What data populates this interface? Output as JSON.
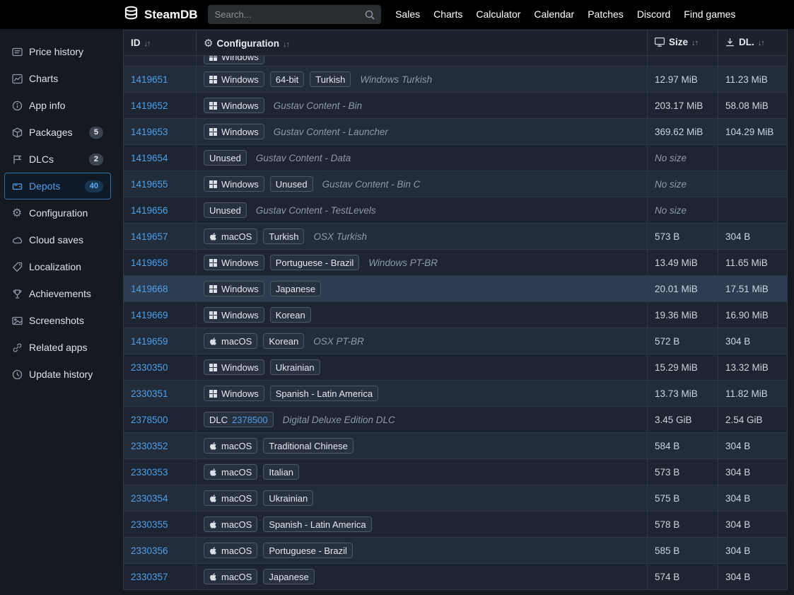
{
  "header": {
    "brand": "SteamDB",
    "search_placeholder": "Search...",
    "nav": [
      "Sales",
      "Charts",
      "Calculator",
      "Calendar",
      "Patches",
      "Discord",
      "Find games"
    ]
  },
  "sidebar": {
    "items": [
      {
        "label": "Price history"
      },
      {
        "label": "Charts"
      },
      {
        "label": "App info"
      },
      {
        "label": "Packages",
        "badge": "5"
      },
      {
        "label": "DLCs",
        "badge": "2"
      },
      {
        "label": "Depots",
        "badge": "40",
        "selected": true
      },
      {
        "label": "Configuration"
      },
      {
        "label": "Cloud saves"
      },
      {
        "label": "Localization"
      },
      {
        "label": "Achievements"
      },
      {
        "label": "Screenshots"
      },
      {
        "label": "Related apps"
      },
      {
        "label": "Update history"
      }
    ]
  },
  "table": {
    "sort_indicator": "↓↑",
    "columns": [
      {
        "label": "ID"
      },
      {
        "label": "Configuration"
      },
      {
        "label": "Size"
      },
      {
        "label": "DL."
      }
    ],
    "rows": [
      {
        "partial": true,
        "badges": [
          {
            "type": "windows",
            "label": "Windows"
          }
        ]
      },
      {
        "id": "1419651",
        "badges": [
          {
            "type": "windows",
            "label": "Windows"
          },
          {
            "type": "plain",
            "label": "64-bit"
          },
          {
            "type": "plain",
            "label": "Turkish"
          }
        ],
        "desc": "Windows Turkish",
        "size": "12.97 MiB",
        "dl": "11.23 MiB"
      },
      {
        "id": "1419652",
        "badges": [
          {
            "type": "windows",
            "label": "Windows"
          }
        ],
        "desc": "Gustav Content - Bin",
        "size": "203.17 MiB",
        "dl": "58.08 MiB"
      },
      {
        "id": "1419653",
        "badges": [
          {
            "type": "windows",
            "label": "Windows"
          }
        ],
        "desc": "Gustav Content - Launcher",
        "size": "369.62 MiB",
        "dl": "104.29 MiB"
      },
      {
        "id": "1419654",
        "badges": [
          {
            "type": "plain",
            "label": "Unused"
          }
        ],
        "desc": "Gustav Content - Data",
        "size": "No size",
        "size_italic": true,
        "dl": ""
      },
      {
        "id": "1419655",
        "badges": [
          {
            "type": "windows",
            "label": "Windows"
          },
          {
            "type": "plain",
            "label": "Unused"
          }
        ],
        "desc": "Gustav Content - Bin C",
        "size": "No size",
        "size_italic": true,
        "dl": ""
      },
      {
        "id": "1419656",
        "badges": [
          {
            "type": "plain",
            "label": "Unused"
          }
        ],
        "desc": "Gustav Content - TestLevels",
        "size": "No size",
        "size_italic": true,
        "dl": ""
      },
      {
        "id": "1419657",
        "badges": [
          {
            "type": "macos",
            "label": "macOS"
          },
          {
            "type": "plain",
            "label": "Turkish"
          }
        ],
        "desc": "OSX Turkish",
        "size": "573 B",
        "dl": "304 B"
      },
      {
        "id": "1419658",
        "badges": [
          {
            "type": "windows",
            "label": "Windows"
          },
          {
            "type": "plain",
            "label": "Portuguese - Brazil"
          }
        ],
        "desc": "Windows PT-BR",
        "size": "13.49 MiB",
        "dl": "11.65 MiB"
      },
      {
        "id": "1419668",
        "badges": [
          {
            "type": "windows",
            "label": "Windows"
          },
          {
            "type": "plain",
            "label": "Japanese"
          }
        ],
        "desc": "",
        "size": "20.01 MiB",
        "dl": "17.51 MiB",
        "highlight": true
      },
      {
        "id": "1419669",
        "badges": [
          {
            "type": "windows",
            "label": "Windows"
          },
          {
            "type": "plain",
            "label": "Korean"
          }
        ],
        "desc": "",
        "size": "19.36 MiB",
        "dl": "16.90 MiB"
      },
      {
        "id": "1419659",
        "badges": [
          {
            "type": "macos",
            "label": "macOS"
          },
          {
            "type": "plain",
            "label": "Korean"
          }
        ],
        "desc": "OSX PT-BR",
        "size": "572 B",
        "dl": "304 B"
      },
      {
        "id": "2330350",
        "badges": [
          {
            "type": "windows",
            "label": "Windows"
          },
          {
            "type": "plain",
            "label": "Ukrainian"
          }
        ],
        "desc": "",
        "size": "15.29 MiB",
        "dl": "13.32 MiB"
      },
      {
        "id": "2330351",
        "badges": [
          {
            "type": "windows",
            "label": "Windows"
          },
          {
            "type": "plain",
            "label": "Spanish - Latin America"
          }
        ],
        "desc": "",
        "size": "13.73 MiB",
        "dl": "11.82 MiB"
      },
      {
        "id": "2378500",
        "badges": [
          {
            "type": "dlc",
            "label": "DLC",
            "link": "2378500"
          }
        ],
        "desc": "Digital Deluxe Edition DLC",
        "size": "3.45 GiB",
        "dl": "2.54 GiB"
      },
      {
        "id": "2330352",
        "badges": [
          {
            "type": "macos",
            "label": "macOS"
          },
          {
            "type": "plain",
            "label": "Traditional Chinese"
          }
        ],
        "desc": "",
        "size": "584 B",
        "dl": "304 B"
      },
      {
        "id": "2330353",
        "badges": [
          {
            "type": "macos",
            "label": "macOS"
          },
          {
            "type": "plain",
            "label": "Italian"
          }
        ],
        "desc": "",
        "size": "573 B",
        "dl": "304 B"
      },
      {
        "id": "2330354",
        "badges": [
          {
            "type": "macos",
            "label": "macOS"
          },
          {
            "type": "plain",
            "label": "Ukrainian"
          }
        ],
        "desc": "",
        "size": "575 B",
        "dl": "304 B"
      },
      {
        "id": "2330355",
        "badges": [
          {
            "type": "macos",
            "label": "macOS"
          },
          {
            "type": "plain",
            "label": "Spanish - Latin America"
          }
        ],
        "desc": "",
        "size": "578 B",
        "dl": "304 B"
      },
      {
        "id": "2330356",
        "badges": [
          {
            "type": "macos",
            "label": "macOS"
          },
          {
            "type": "plain",
            "label": "Portuguese - Brazil"
          }
        ],
        "desc": "",
        "size": "585 B",
        "dl": "304 B"
      },
      {
        "id": "2330357",
        "badges": [
          {
            "type": "macos",
            "label": "macOS"
          },
          {
            "type": "plain",
            "label": "Japanese"
          }
        ],
        "desc": "",
        "size": "574 B",
        "dl": "304 B"
      }
    ]
  },
  "colors": {
    "link_blue": "#4f9fe8",
    "highlight_row": "#2e3c52",
    "topbar": "#000000",
    "table_bg": "#1c2531"
  }
}
